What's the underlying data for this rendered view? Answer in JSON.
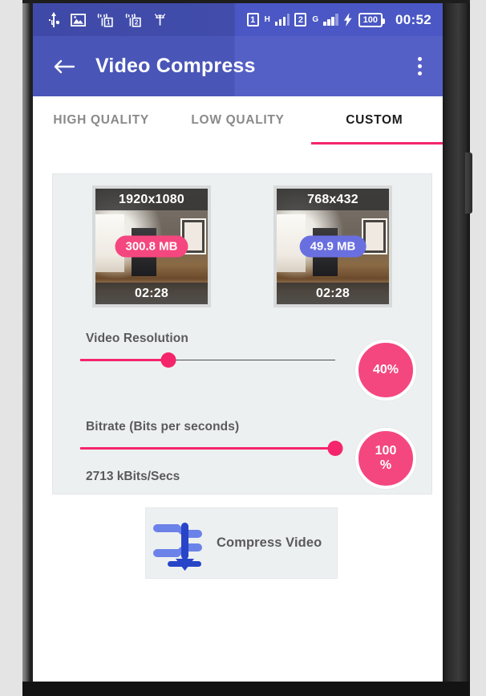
{
  "status_bar": {
    "icons_left": [
      "usb-icon",
      "image-icon",
      "signal-sim1-icon",
      "signal-sim2-icon",
      "android-icon"
    ],
    "sim1_label": "1",
    "sim1_network": "H",
    "sim2_label": "2",
    "sim2_network": "G",
    "battery_level": "100",
    "charging_icon": "bolt-icon",
    "clock": "00:52"
  },
  "app_bar": {
    "back_icon": "arrow-back-icon",
    "title": "Video Compress",
    "overflow_icon": "more-vert-icon"
  },
  "tabs": {
    "items": [
      {
        "label": "HIGH QUALITY",
        "active": false
      },
      {
        "label": "LOW QUALITY",
        "active": false
      },
      {
        "label": "CUSTOM",
        "active": true
      }
    ],
    "indicator_color": "#f4256a"
  },
  "thumbnails": [
    {
      "name": "source-video-thumbnail",
      "resolution": "1920x1080",
      "size": "300.8 MB",
      "duration": "02:28",
      "pill_color": "#f4477f"
    },
    {
      "name": "output-video-thumbnail",
      "resolution": "768x432",
      "size": "49.9 MB",
      "duration": "02:28",
      "pill_color": "#6a6fe0"
    }
  ],
  "sliders": [
    {
      "name": "video-resolution-slider",
      "label": "Video Resolution",
      "value": 40,
      "badge_line1": "40%",
      "badge_line2": "",
      "subtext": ""
    },
    {
      "name": "bitrate-slider",
      "label": "Bitrate (Bits per seconds)",
      "value": 100,
      "badge_line1": "100",
      "badge_line2": "%",
      "subtext": "2713 kBits/Secs"
    }
  ],
  "compress_button": {
    "label": "Compress Video",
    "icon": "compress-arrows-icon"
  },
  "colors": {
    "accent_pink": "#f4256a",
    "badge_pink": "#f4477f",
    "app_bar_blue": "#4a55b8",
    "status_bar_blue": "#3f4aa8",
    "card_gray": "#edf0f1",
    "icon_blue": "#5a74e0"
  }
}
